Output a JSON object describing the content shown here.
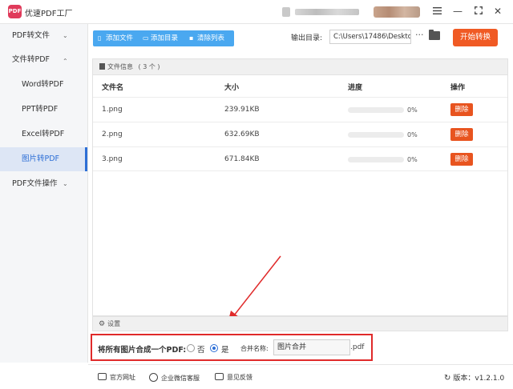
{
  "app": {
    "logo_text": "PDF",
    "title": "优速PDF工厂"
  },
  "window": {
    "menu_icon": "hamburger-icon",
    "minimize": "—",
    "maximize": "⛶",
    "close": "✕"
  },
  "sidebar": {
    "items": [
      {
        "label": "PDF转文件",
        "chevron": "⌄"
      },
      {
        "label": "文件转PDF",
        "chevron": "⌃"
      },
      {
        "label": "Word转PDF"
      },
      {
        "label": "PPT转PDF"
      },
      {
        "label": "Excel转PDF"
      },
      {
        "label": "图片转PDF",
        "active": true
      },
      {
        "label": "PDF文件操作",
        "chevron": "⌄"
      }
    ]
  },
  "toolbar": {
    "add_file": "添加文件",
    "add_dir": "添加目录",
    "clear_list": "清除列表",
    "output_label": "输出目录:",
    "output_path": "C:\\Users\\17486\\Deskto",
    "more": "···",
    "start": "开始转换"
  },
  "file_panel": {
    "header_label": "文件信息",
    "header_count": "( 3 个 )",
    "columns": {
      "name": "文件名",
      "size": "大小",
      "progress": "进度",
      "action": "操作"
    },
    "rows": [
      {
        "name": "1.png",
        "size": "239.91KB",
        "progress": "0%",
        "progress_value": 0,
        "action": "删除"
      },
      {
        "name": "2.png",
        "size": "632.69KB",
        "progress": "0%",
        "progress_value": 0,
        "action": "删除"
      },
      {
        "name": "3.png",
        "size": "671.84KB",
        "progress": "0%",
        "progress_value": 0,
        "action": "删除"
      }
    ]
  },
  "settings": {
    "header": "设置",
    "merge_label": "将所有图片合成一个PDF:",
    "option_no": "否",
    "option_yes": "是",
    "selected": "是",
    "name_label": "合并名称:",
    "name_value": "图片合并",
    "extension": ".pdf"
  },
  "footer": {
    "website": "官方网址",
    "wechat": "企业微信客服",
    "feedback": "意见反馈",
    "version": "版本：v1.2.1.0"
  },
  "colors": {
    "accent_blue": "#4aa8f0",
    "active_blue": "#2d6fd6",
    "start_orange": "#f05a24",
    "delete_orange": "#e8541f",
    "annotation_red": "#e02a2a"
  }
}
